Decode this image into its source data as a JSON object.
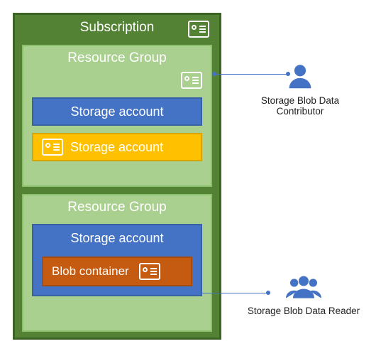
{
  "subscription": {
    "title": "Subscription"
  },
  "rg1": {
    "title": "Resource Group",
    "storage1": "Storage account",
    "storage2": "Storage account"
  },
  "rg2": {
    "title": "Resource Group",
    "storage3": "Storage account",
    "blob": "Blob container"
  },
  "actors": {
    "contributor": "Storage Blob Data Contributor",
    "reader": "Storage Blob Data Reader"
  },
  "colors": {
    "azure_blue": "#4472c4",
    "subscription_green": "#548235",
    "rg_green": "#a9d08e",
    "gold": "#ffc000",
    "orange": "#c55a11"
  }
}
